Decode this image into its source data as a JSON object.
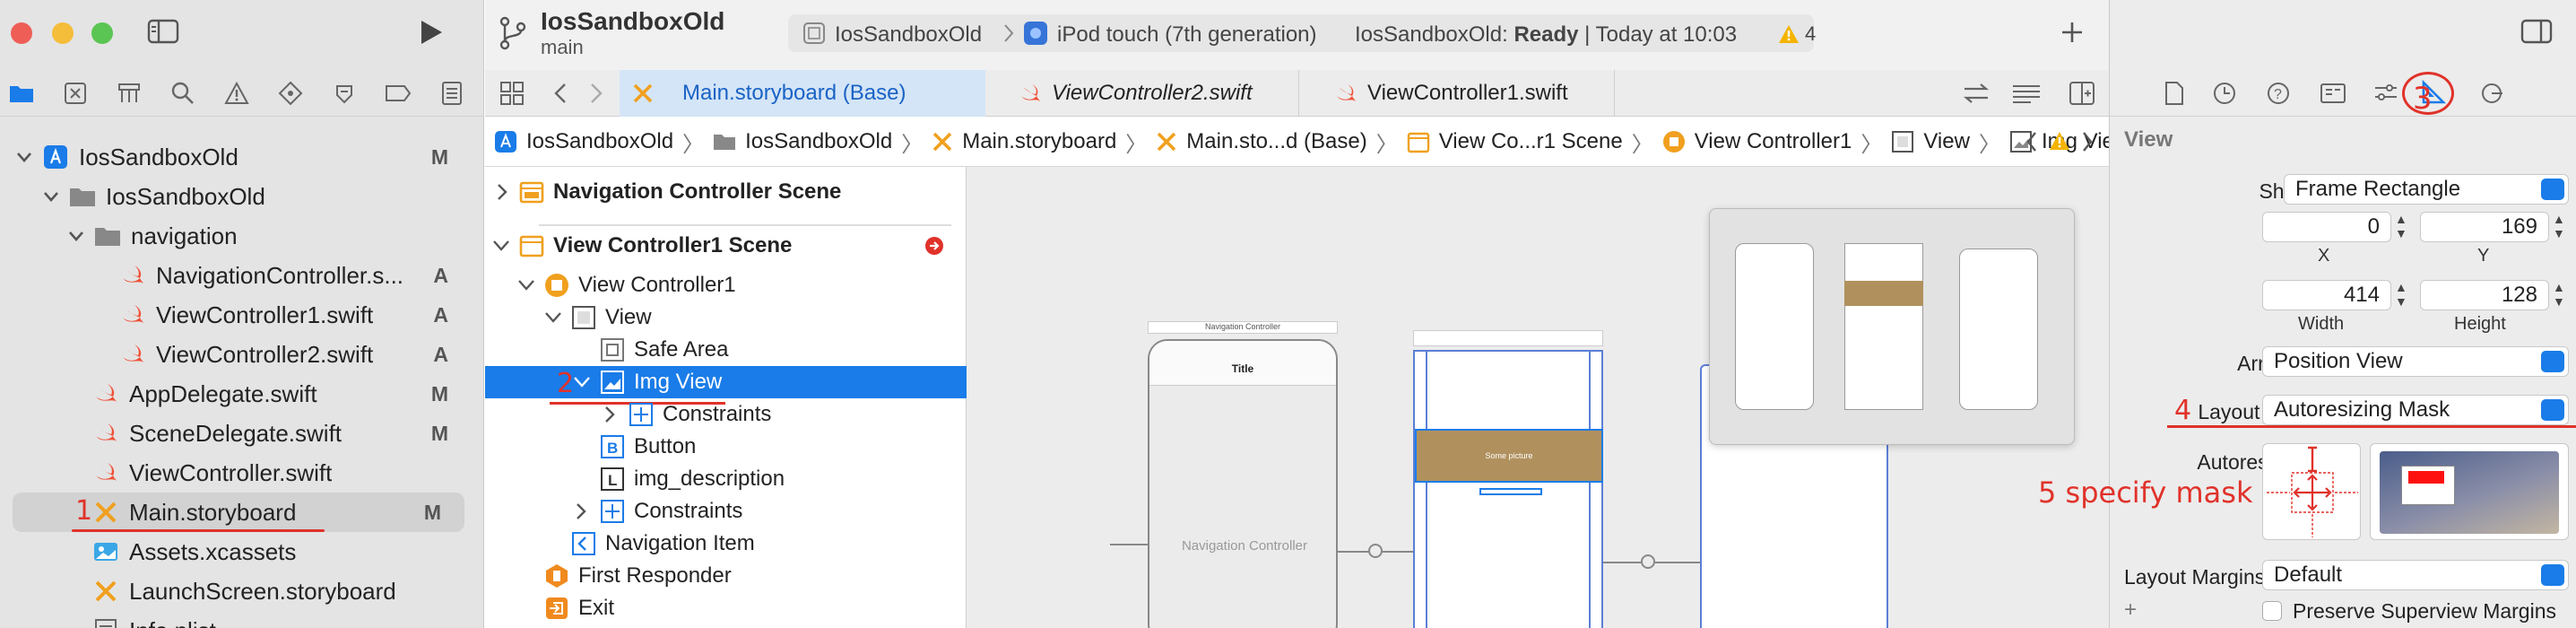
{
  "window": {
    "project_name": "IosSandboxOld",
    "branch": "main"
  },
  "toolbar": {
    "scheme": "IosSandboxOld",
    "device": "iPod touch (7th generation)",
    "status_prefix": "IosSandboxOld: ",
    "status_bold": "Ready",
    "status_time": "| Today at 10:03",
    "warning_count": "4"
  },
  "navigator": {
    "items": [
      {
        "label": "IosSandboxOld",
        "status": "M"
      },
      {
        "label": "IosSandboxOld",
        "status": ""
      },
      {
        "label": "navigation",
        "status": ""
      },
      {
        "label": "NavigationController.s...",
        "status": "A"
      },
      {
        "label": "ViewController1.swift",
        "status": "A"
      },
      {
        "label": "ViewController2.swift",
        "status": "A"
      },
      {
        "label": "AppDelegate.swift",
        "status": "M"
      },
      {
        "label": "SceneDelegate.swift",
        "status": "M"
      },
      {
        "label": "ViewController.swift",
        "status": ""
      },
      {
        "label": "Main.storyboard",
        "status": "M"
      },
      {
        "label": "Assets.xcassets",
        "status": ""
      },
      {
        "label": "LaunchScreen.storyboard",
        "status": ""
      },
      {
        "label": "Info.plist",
        "status": ""
      }
    ]
  },
  "editor_tabs": [
    {
      "label": "Main.storyboard (Base)"
    },
    {
      "label": "ViewController2.swift"
    },
    {
      "label": "ViewController1.swift"
    }
  ],
  "jump_bar": [
    "IosSandboxOld",
    "IosSandboxOld",
    "Main.storyboard",
    "Main.sto...d (Base)",
    "View Co...r1 Scene",
    "View Controller1",
    "View",
    "Img View"
  ],
  "outline": [
    {
      "label": "Navigation Controller Scene"
    },
    {
      "label": "View Controller1 Scene"
    },
    {
      "label": "View Controller1"
    },
    {
      "label": "View"
    },
    {
      "label": "Safe Area"
    },
    {
      "label": "Img View"
    },
    {
      "label": "Constraints"
    },
    {
      "label": "Button"
    },
    {
      "label": "img_description"
    },
    {
      "label": "Constraints"
    },
    {
      "label": "Navigation Item"
    },
    {
      "label": "First Responder"
    },
    {
      "label": "Exit"
    }
  ],
  "canvas": {
    "nav_controller_header": "Navigation Controller",
    "nav_title": "Title",
    "nav_controller_label": "Navigation Controller",
    "img_text": "Some picture"
  },
  "inspector": {
    "section_title": "View",
    "show_label": "Show",
    "show_value": "Frame Rectangle",
    "x_value": "0",
    "y_value": "169",
    "x_label": "X",
    "y_label": "Y",
    "width_value": "414",
    "height_value": "128",
    "width_label": "Width",
    "height_label": "Height",
    "arrange_label": "Arrange",
    "arrange_value": "Position View",
    "layout_label": "Layout",
    "layout_value": "Autoresizing Mask",
    "autoresizing_label": "Autoresizing",
    "layout_margins_label": "Layout Margins",
    "layout_margins_value": "Default",
    "preserve_label": "Preserve Superview Margins"
  },
  "annotations": {
    "n1": "1",
    "n2": "2",
    "n3": "3",
    "n4": "4",
    "n5": "5 specify mask"
  },
  "colors": {
    "accent": "#1a7ce8",
    "annotation": "#e0322a",
    "selection": "#1a7ce8",
    "swift": "#f05138",
    "storyboard": "#f0a01e"
  }
}
